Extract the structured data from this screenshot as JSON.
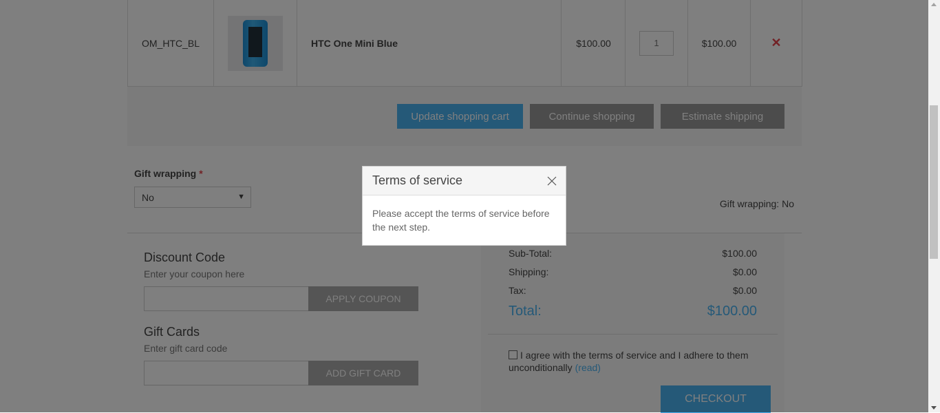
{
  "cart_item": {
    "sku": "OM_HTC_BL",
    "image_alt": "HTC One Mini Blue phone",
    "name": "HTC One Mini Blue",
    "unit_price": "$100.00",
    "quantity": "1",
    "subtotal": "$100.00",
    "remove_icon": "close-x-icon"
  },
  "cart_buttons": {
    "update": "Update shopping cart",
    "continue": "Continue shopping",
    "estimate": "Estimate shipping"
  },
  "gift_wrapping": {
    "label": "Gift wrapping",
    "required_mark": "*",
    "selected": "No",
    "summary": "Gift wrapping: No"
  },
  "discount": {
    "title": "Discount Code",
    "hint": "Enter your coupon here",
    "button": "APPLY COUPON"
  },
  "gift_cards": {
    "title": "Gift Cards",
    "hint": "Enter gift card code",
    "button": "ADD GIFT CARD"
  },
  "totals": {
    "subtotal_label": "Sub-Total:",
    "subtotal_value": "$100.00",
    "shipping_label": "Shipping:",
    "shipping_value": "$0.00",
    "tax_label": "Tax:",
    "tax_value": "$0.00",
    "total_label": "Total:",
    "total_value": "$100.00",
    "agree_text": "I agree with the terms of service and I adhere to them unconditionally",
    "read_link": "(read)",
    "checkout": "CHECKOUT"
  },
  "dialog": {
    "title": "Terms of service",
    "message": "Please accept the terms of service before the next step."
  },
  "colors": {
    "accent": "#4ab2f1",
    "remove": "#e4434b",
    "overlay": "rgba(0,0,0,0.5)"
  }
}
